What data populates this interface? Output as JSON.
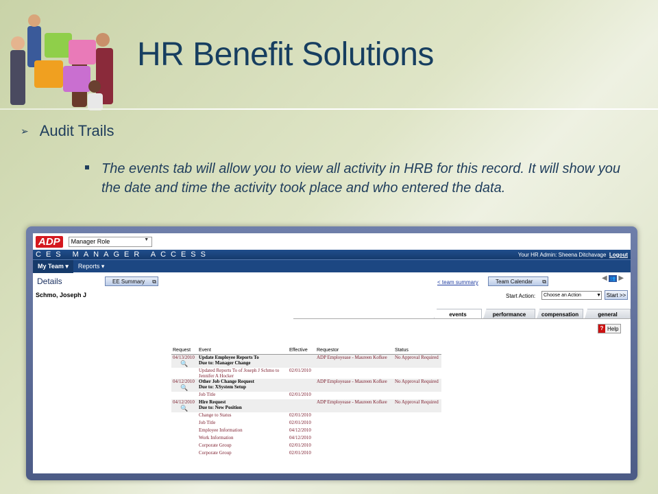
{
  "slide": {
    "title": "HR Benefit Solutions",
    "bullet1": "Audit Trails",
    "bullet2": "The events tab will allow you to view all activity in HRB for this record.  It will show you the date and time the activity took place and who entered the data."
  },
  "app": {
    "logo": "ADP",
    "role_select": "Manager Role",
    "banner": "CES MANAGER ACCESS",
    "admin_prefix": "Your HR Admin: Sheena Ditchavage",
    "logout": "Logout",
    "nav": [
      "My Team",
      "Reports"
    ],
    "details_heading": "Details",
    "employee_name": "Schmo, Joseph J",
    "ee_summary_btn": "EE Summary",
    "team_summary_link": "< team summary",
    "team_calendar_btn": "Team Calendar",
    "start_action_label": "Start Action:",
    "start_action_select": "Choose an Action",
    "start_button": "Start >>",
    "tabs": [
      "events",
      "performance",
      "compensation",
      "general"
    ],
    "help": "Help",
    "table_headers": [
      "Request",
      "Event",
      "Effective",
      "Requestor",
      "Status"
    ],
    "rows": [
      {
        "type": "main",
        "date": "04/13/2010",
        "event": "Update Employee Reports To",
        "reason": "Due to: Manager Change",
        "effective": "",
        "requestor": "ADP Employease - Maureen Kofkee",
        "status": "No Approval Required"
      },
      {
        "type": "sub",
        "event": "Updated Reports To of Joseph J Schmo to",
        "event2": "Jennifer A Hocker",
        "effective": "02/01/2010"
      },
      {
        "type": "main",
        "date": "04/12/2010",
        "event": "Other Job Change Request",
        "reason": "Due to: XSystem Setup",
        "effective": "",
        "requestor": "ADP Employease - Maureen Kofkee",
        "status": "No Approval Required"
      },
      {
        "type": "sub",
        "event": "Job Title",
        "effective": "02/01/2010"
      },
      {
        "type": "main",
        "date": "04/12/2010",
        "event": "Hire Request",
        "reason": "Due to: New Position",
        "effective": "",
        "requestor": "ADP Employease - Maureen Kofkee",
        "status": "No Approval Required"
      },
      {
        "type": "sub",
        "event": "Change to Status",
        "effective": "02/01/2010"
      },
      {
        "type": "sub",
        "event": "Job Title",
        "effective": "02/01/2010"
      },
      {
        "type": "sub",
        "event": "Employee Information",
        "effective": "04/12/2010"
      },
      {
        "type": "sub",
        "event": "Work Information",
        "effective": "04/12/2010"
      },
      {
        "type": "sub",
        "event": "Corporate Group",
        "effective": "02/01/2010"
      },
      {
        "type": "sub",
        "event": "Corporate Group",
        "effective": "02/01/2010"
      }
    ]
  }
}
